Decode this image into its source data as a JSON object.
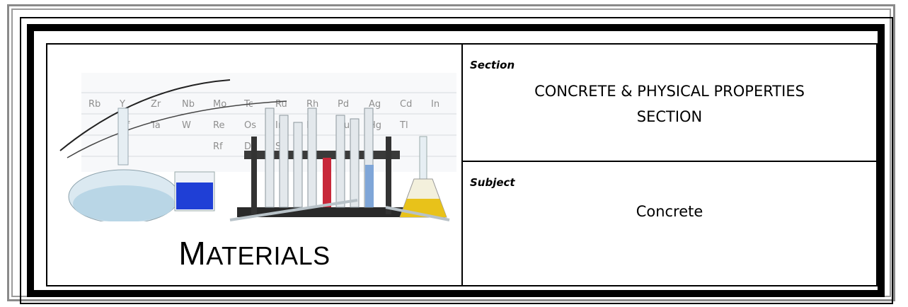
{
  "materials_title": {
    "first_letter": "M",
    "rest": "ATERIALS"
  },
  "section": {
    "label": "Section",
    "value": "CONCRETE & PHYSICAL PROPERTIES SECTION"
  },
  "subject": {
    "label": "Subject",
    "value": "Concrete"
  },
  "illustration": {
    "periodic_table_symbols": [
      "Rb",
      "Y",
      "Zr",
      "Nb",
      "Mo",
      "Tc",
      "Ru",
      "Rh",
      "Pd",
      "Ag",
      "Cd",
      "In",
      "Hf",
      "Ta",
      "W",
      "Re",
      "Os",
      "Ir",
      "Pt",
      "Au",
      "Hg",
      "Tl",
      "Rf",
      "Db",
      "Sg"
    ],
    "colors": {
      "blue_liquid": "#1f3fd6",
      "yellow_liquid": "#e8c21a",
      "red_liquid": "#c8283a",
      "glass": "#d8e6ee"
    }
  }
}
